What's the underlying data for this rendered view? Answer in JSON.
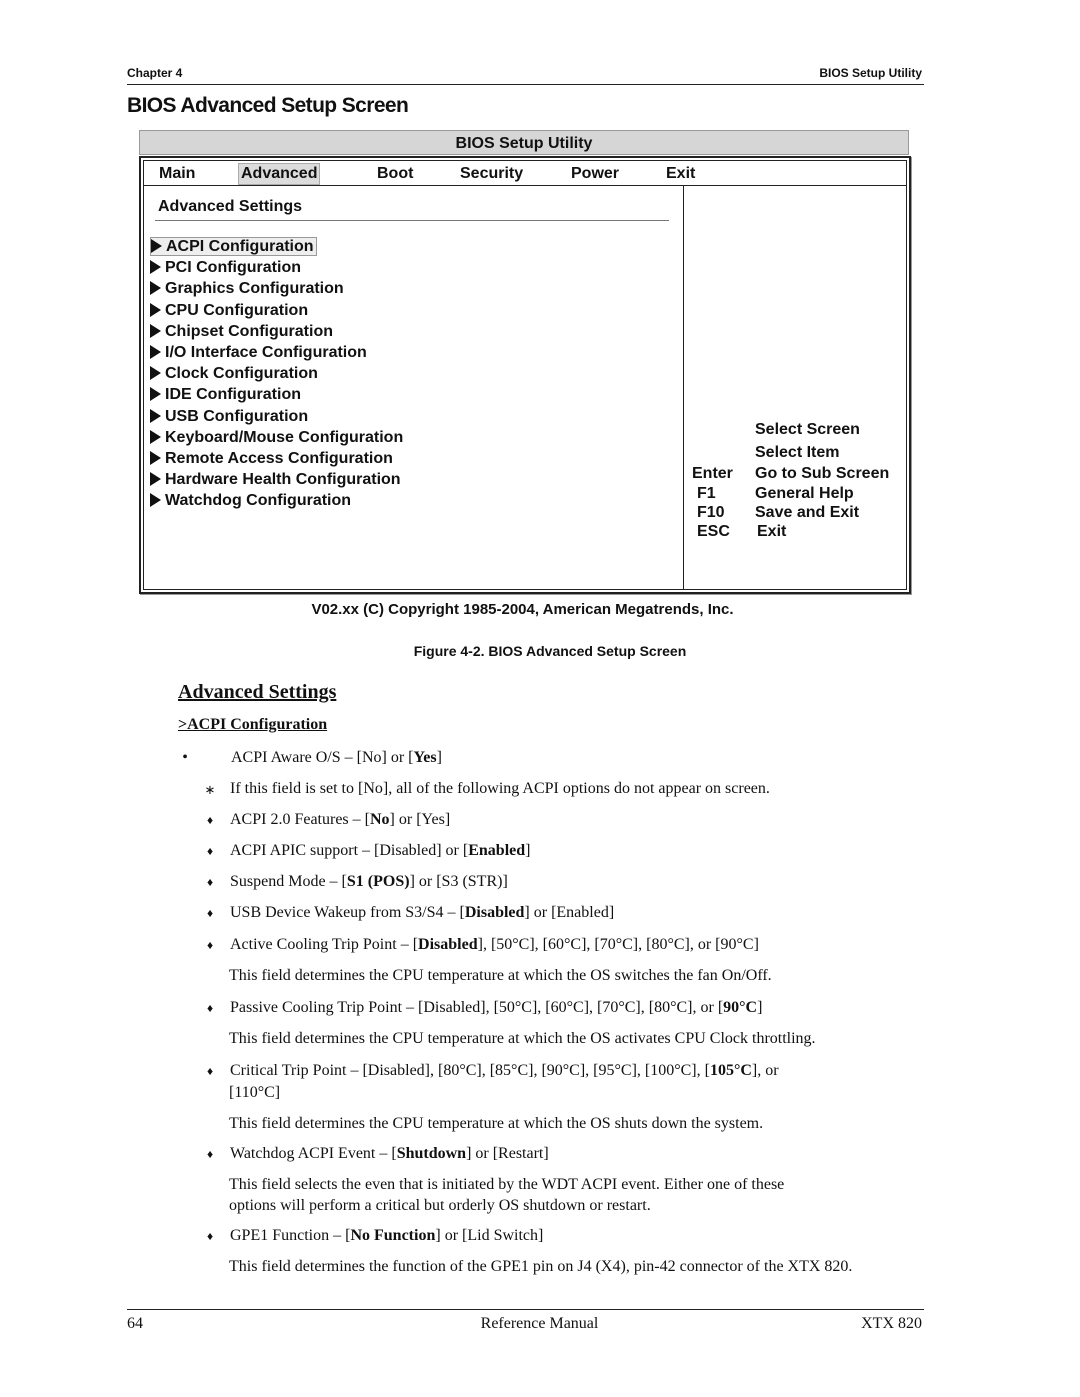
{
  "header": {
    "chapter": "Chapter 4",
    "section": "BIOS Setup Utility"
  },
  "section_title": "BIOS Advanced Setup Screen",
  "bios": {
    "title": "BIOS Setup Utility",
    "menu": [
      {
        "label": "Main",
        "active": false
      },
      {
        "label": "Advanced",
        "active": true
      },
      {
        "label": "Boot",
        "active": false
      },
      {
        "label": "Security",
        "active": false
      },
      {
        "label": "Power",
        "active": false
      },
      {
        "label": "Exit",
        "active": false
      }
    ],
    "settings_heading": "Advanced Settings",
    "items": [
      {
        "label": "ACPI Configuration",
        "selected": true
      },
      {
        "label": "PCI Configuration"
      },
      {
        "label": "Graphics Configuration"
      },
      {
        "label": "CPU Configuration"
      },
      {
        "label": "Chipset Configuration"
      },
      {
        "label": "I/O Interface Configuration"
      },
      {
        "label": "Clock Configuration"
      },
      {
        "label": "IDE Configuration"
      },
      {
        "label": "USB Configuration"
      },
      {
        "label": "Keyboard/Mouse Configuration"
      },
      {
        "label": "Remote Access Configuration"
      },
      {
        "label": "Hardware Health Configuration"
      },
      {
        "label": "Watchdog Configuration"
      }
    ],
    "help": [
      {
        "key": "",
        "desc": "Select Screen"
      },
      {
        "key": "",
        "desc": "Select Item"
      },
      {
        "key": "Enter",
        "desc": "Go to Sub Screen"
      },
      {
        "key": "F1",
        "desc": "General Help"
      },
      {
        "key": "F10",
        "desc": "Save and Exit"
      },
      {
        "key": "ESC",
        "desc": "Exit"
      }
    ],
    "copyright": "V02.xx  (C) Copyright 1985-2004,  American Megatrends, Inc."
  },
  "figure_caption": "Figure 4-2.  BIOS Advanced Setup Screen",
  "body": {
    "heading": "Advanced Settings",
    "subheading": ">ACPI Configuration",
    "glyphs": {
      "dot": "•",
      "star": "∗",
      "diamond": "♦"
    },
    "lines": {
      "acpi_aware": [
        "ACPI Aware O/S – [No] or [",
        "Yes",
        "]"
      ],
      "acpi_aware_note": "If this field is set to [No], all of the following ACPI options do not appear on screen.",
      "acpi20": [
        "ACPI 2.0 Features – [",
        "No",
        "] or [Yes]"
      ],
      "apic": [
        "ACPI APIC support – [Disabled] or [",
        "Enabled",
        "]"
      ],
      "suspend": [
        "Suspend Mode – [",
        "S1 (POS)",
        "] or [S3 (STR)]"
      ],
      "usb_wake": [
        "USB Device Wakeup from S3/S4 – [",
        "Disabled",
        "] or [Enabled]"
      ],
      "active_cool": [
        "Active Cooling Trip Point – [",
        "Disabled",
        "], [50°C], [60°C], [70°C], [80°C], or [90°C]"
      ],
      "active_cool_desc": "This field determines the CPU temperature at which the OS switches the fan On/Off.",
      "passive_cool": [
        "Passive Cooling Trip Point – [Disabled], [50°C], [60°C], [70°C], [80°C], or [",
        "90°C",
        "]"
      ],
      "passive_cool_desc": "This field determines the CPU temperature at which the OS activates CPU Clock throttling.",
      "critical": [
        "Critical Trip Point – [Disabled], [80°C], [85°C], [90°C], [95°C], [100°C], [",
        "105°C",
        "], or"
      ],
      "critical_cont": "[110°C]",
      "critical_desc": "This field determines the CPU temperature at which the OS shuts down the system.",
      "watchdog": [
        "Watchdog ACPI Event – [",
        "Shutdown",
        "] or [Restart]"
      ],
      "watchdog_desc1": "This field selects the even that is initiated by the WDT ACPI event.  Either one of these",
      "watchdog_desc2": "options will perform a critical but orderly OS shutdown or restart.",
      "gpe1": [
        "GPE1 Function – [",
        "No Function",
        "] or [Lid Switch]"
      ],
      "gpe1_desc": "This field determines the function of the GPE1 pin on J4 (X4), pin-42 connector of the XTX 820."
    }
  },
  "footer": {
    "page_number": "64",
    "title": "Reference Manual",
    "product": "XTX 820"
  }
}
